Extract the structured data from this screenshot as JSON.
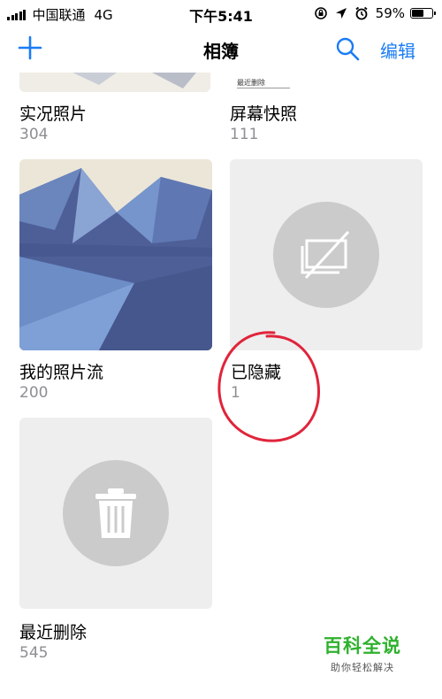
{
  "status_bar": {
    "carrier": "中国联通",
    "network": "4G",
    "time": "下午5:41",
    "battery_percent": "59%",
    "battery_level": 0.59
  },
  "nav": {
    "title": "相簿",
    "edit_label": "编辑"
  },
  "albums": [
    {
      "title": "实况照片",
      "count": "304"
    },
    {
      "title": "屏幕快照",
      "count": "111",
      "thumb_label": "最近删除"
    },
    {
      "title": "我的照片流",
      "count": "200"
    },
    {
      "title": "已隐藏",
      "count": "1"
    },
    {
      "title": "最近删除",
      "count": "545"
    }
  ],
  "watermark": {
    "title": "百科全说",
    "subtitle": "助你轻松解决"
  },
  "colors": {
    "accent": "#1a7cf5",
    "annotation": "#e0243a",
    "watermark": "#2fb12d",
    "placeholder_bg": "#eeeeee",
    "placeholder_circle": "#cbcbcb",
    "secondary_text": "#8e8e93"
  }
}
